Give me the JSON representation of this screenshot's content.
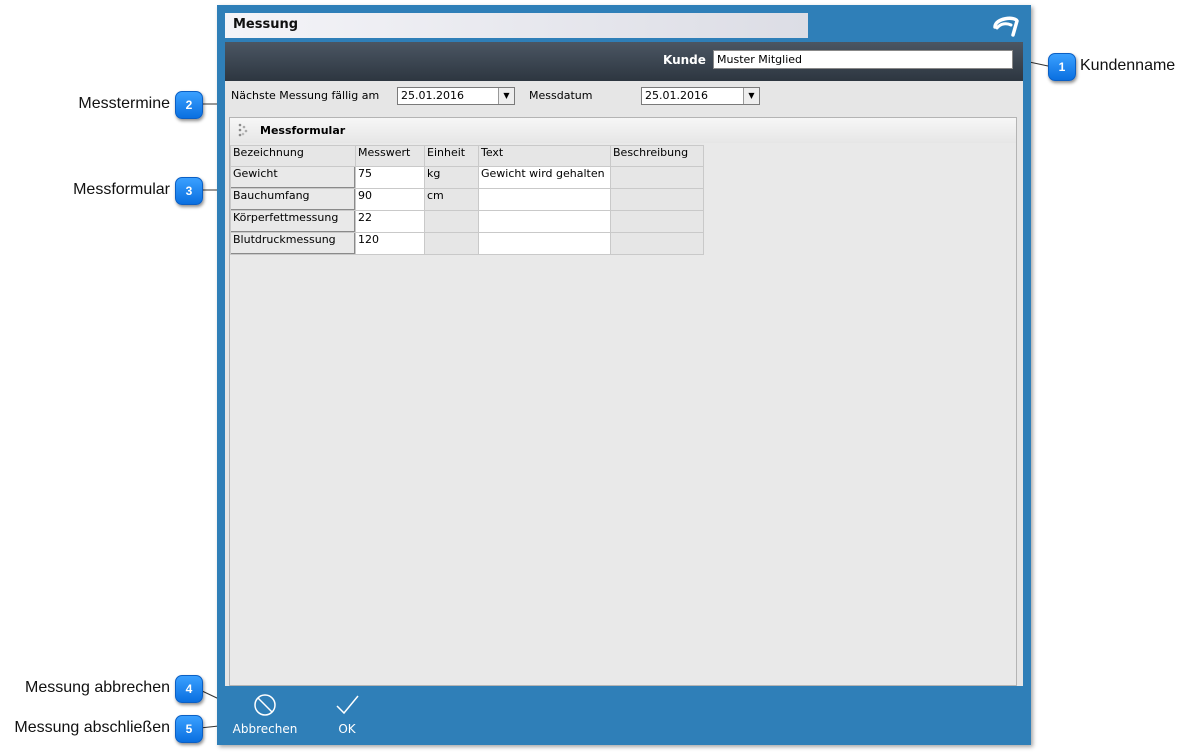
{
  "window": {
    "title": "Messung"
  },
  "kunde": {
    "label": "Kunde",
    "value": "Muster Mitglied"
  },
  "dates": {
    "next_label": "Nächste Messung fällig am",
    "next_value": "25.01.2016",
    "messdatum_label": "Messdatum",
    "messdatum_value": "25.01.2016"
  },
  "form": {
    "title": "Messformular",
    "columns": [
      "Bezeichnung",
      "Messwert",
      "Einheit",
      "Text",
      "Beschreibung"
    ],
    "rows": [
      {
        "name": "Gewicht",
        "value": "75",
        "unit": "kg",
        "text": "Gewicht wird gehalten",
        "desc": ""
      },
      {
        "name": "Bauchumfang",
        "value": "90",
        "unit": "cm",
        "text": "",
        "desc": ""
      },
      {
        "name": "Körperfettmessung",
        "value": "22",
        "unit": "",
        "text": "",
        "desc": ""
      },
      {
        "name": "Blutdruckmessung",
        "value": "120",
        "unit": "",
        "text": "",
        "desc": ""
      }
    ]
  },
  "footer": {
    "cancel_label": "Abbrechen",
    "ok_label": "OK"
  },
  "callouts": [
    {
      "number": "1",
      "label": "Kundenname"
    },
    {
      "number": "2",
      "label": "Messtermine"
    },
    {
      "number": "3",
      "label": "Messformular"
    },
    {
      "number": "4",
      "label": "Messung abbrechen"
    },
    {
      "number": "5",
      "label": "Messung abschließen"
    }
  ],
  "colors": {
    "window_blue": "#2f7fb8",
    "badge_blue": "#1a86f0",
    "header_dark": "#2d3640"
  },
  "icons": [
    "app-logo-icon",
    "grip-dots-icon",
    "chevron-down-icon",
    "cancel-circle-icon",
    "checkmark-icon"
  ]
}
